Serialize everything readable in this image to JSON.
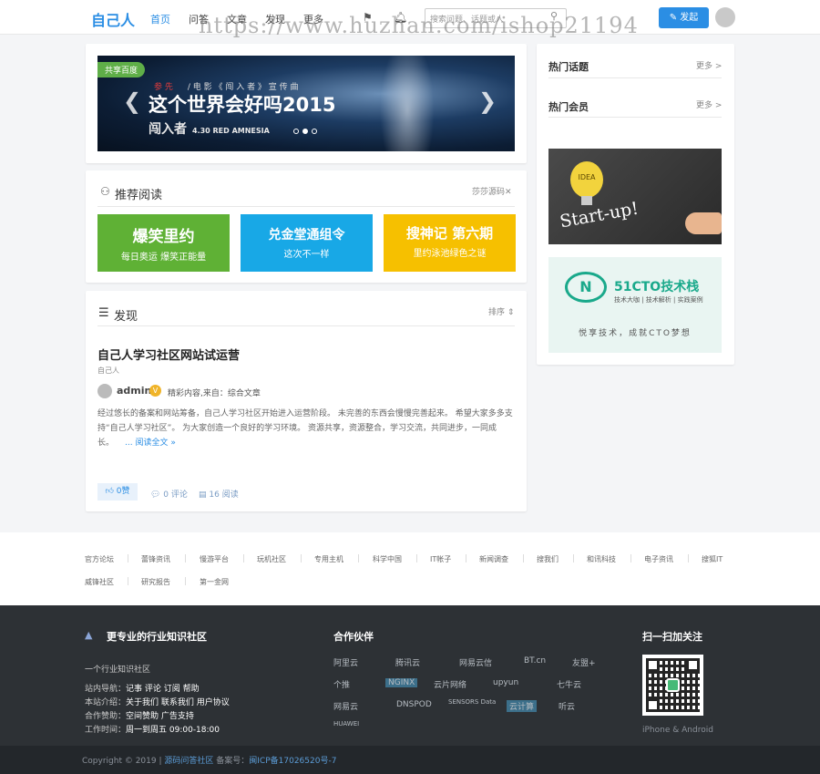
{
  "header": {
    "logo": "自己人",
    "nav": [
      "首页",
      "问答",
      "文章",
      "发现",
      "更多"
    ],
    "search_placeholder": "搜索问题、话题或人",
    "post_label": "发起",
    "watermark": "https://www.huzhan.com/ishop21194"
  },
  "banner": {
    "tag": "共享百度",
    "sub_red": "参 先",
    "sub": "/ 电 影 《 闯 入 者 》 宣 传 曲",
    "title": "这个世界会好吗2015",
    "logo": "闯入者",
    "logo_small": "4.30 RED AMNESIA"
  },
  "recommend": {
    "title": "推荐阅读",
    "action": "莎莎源码",
    "tiles": [
      {
        "line1": "爆笑里约",
        "line2": "每日奥运  爆笑正能量",
        "color": "#5fb135"
      },
      {
        "line1": "兑金堂通组令",
        "line2": "这次不一样",
        "color": "#18a8e6"
      },
      {
        "line1": "搜神记  第六期",
        "line2": "里约泳池绿色之谜",
        "color": "#f6c000"
      }
    ]
  },
  "discover": {
    "title": "发现",
    "sort": "排序",
    "article": {
      "title": "自己人学习社区网站试运营",
      "author": "自己人",
      "user": "admin",
      "category": "精彩内容,来自：综合文章",
      "body": "经过悠长的备案和网站筹备，自己人学习社区开始进入运营阶段。 未完善的东西会慢慢完善起来。 希望大家多多支持“自己人学习社区”。 为大家创造一个良好的学习环境。 资源共享，资源整合，学习交流，共同进步，一同成长。",
      "more": "... 阅读全文 »",
      "likes": "0赞",
      "comments": "0 评论",
      "reads": "16 阅读"
    }
  },
  "sidebar": {
    "hot_topics": "热门话题",
    "hot_members": "热门会员",
    "more": "更多 >",
    "ad1_text": "Start-up!",
    "ad1_bulb": "IDEA",
    "ad2_brand": "51CTO技术栈",
    "ad2_tags": "技术大咖 | 技术解析 | 实践案例",
    "ad2_slogan": "悦享技术，成就CTO梦想"
  },
  "links": [
    "官方论坛",
    "蕾锋资讯",
    "慢游平台",
    "玩机社区",
    "专用主机",
    "科学中国",
    "IT帐子",
    "新闻调查",
    "搜我们",
    "和讯科技",
    "电子资讯",
    "搜狐IT",
    "威锋社区",
    "研究报告",
    "第一金网"
  ],
  "footer": {
    "slogan": "更专业的行业知识社区",
    "desc": "一个行业知识社区",
    "site_nav_label": "站内导航：",
    "site_nav": "记事 评论 订阅 帮助",
    "site_intro_label": "本站介绍：",
    "site_intro": "关于我们 联系我们 用户协议",
    "coop_label": "合作赞助：",
    "coop": "空间赞助 广告支持",
    "hours_label": "工作时间：",
    "hours": "周一到周五 09:00-18:00",
    "partners_title": "合作伙伴",
    "partners": [
      "阿里云",
      "腾讯云",
      "网易云信",
      "BT.cn",
      "友盟+",
      "个推",
      "NGINX",
      "云片网络",
      "upyun",
      "七牛云",
      "网易云",
      "DNSPOD",
      "SENSORS Data",
      "云计算",
      "听云",
      "HUAWEI"
    ],
    "qr_title": "扫一扫加关注",
    "qr_caption": "iPhone & Android",
    "copyright": "Copyright © 2019 |",
    "copy_link": "源码问答社区",
    "icp_label": "备案号：",
    "icp": "闽ICP备17026520号-7"
  }
}
